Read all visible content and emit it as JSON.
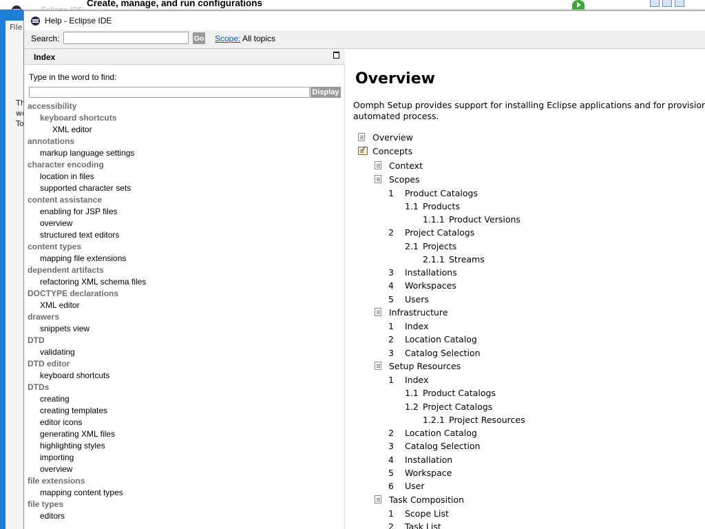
{
  "background_window": {
    "title": "Create, manage, and run configurations",
    "app_label": "Eclipse IDE",
    "menu_file": "File",
    "fragments": [
      "Th",
      "wo",
      "To"
    ]
  },
  "help_window": {
    "title": "Help - Eclipse IDE",
    "search": {
      "label": "Search:",
      "value": "",
      "go_label": "Go",
      "scope_link": "Scope:",
      "scope_value": "All topics"
    }
  },
  "index_pane": {
    "title": "Index",
    "find_label": "Type in the word to find:",
    "find_value": "",
    "display_label": "Display",
    "entries": [
      {
        "level": 0,
        "text": "accessibility"
      },
      {
        "level": "1b",
        "text": "keyboard shortcuts"
      },
      {
        "level": 2,
        "text": "XML editor"
      },
      {
        "level": 0,
        "text": "annotations"
      },
      {
        "level": 1,
        "text": "markup language settings"
      },
      {
        "level": 0,
        "text": "character encoding"
      },
      {
        "level": 1,
        "text": "location in files"
      },
      {
        "level": 1,
        "text": "supported character sets"
      },
      {
        "level": 0,
        "text": "content assistance"
      },
      {
        "level": 1,
        "text": "enabling for JSP files"
      },
      {
        "level": 1,
        "text": "overview"
      },
      {
        "level": 1,
        "text": "structured text editors"
      },
      {
        "level": 0,
        "text": "content types"
      },
      {
        "level": 1,
        "text": "mapping file extensions"
      },
      {
        "level": 0,
        "text": "dependent artifacts"
      },
      {
        "level": 1,
        "text": "refactoring XML schema files"
      },
      {
        "level": 0,
        "text": "DOCTYPE declarations"
      },
      {
        "level": 1,
        "text": "XML editor"
      },
      {
        "level": 0,
        "text": "drawers"
      },
      {
        "level": 1,
        "text": "snippets view"
      },
      {
        "level": 0,
        "text": "DTD"
      },
      {
        "level": 1,
        "text": "validating"
      },
      {
        "level": 0,
        "text": "DTD editor"
      },
      {
        "level": 1,
        "text": "keyboard shortcuts"
      },
      {
        "level": 0,
        "text": "DTDs"
      },
      {
        "level": 1,
        "text": "creating"
      },
      {
        "level": 1,
        "text": "creating templates"
      },
      {
        "level": 1,
        "text": "editor icons"
      },
      {
        "level": 1,
        "text": "generating XML files"
      },
      {
        "level": 1,
        "text": "highlighting styles"
      },
      {
        "level": 1,
        "text": "importing"
      },
      {
        "level": 1,
        "text": "overview"
      },
      {
        "level": 0,
        "text": "file extensions"
      },
      {
        "level": 1,
        "text": "mapping content types"
      },
      {
        "level": 0,
        "text": "file types"
      },
      {
        "level": 1,
        "text": "editors"
      }
    ]
  },
  "content_pane": {
    "title": "Overview",
    "intro_line1": "Oomph Setup provides support for installing Eclipse applications and for provisioning Ec",
    "intro_line2": "automated process.",
    "toc": [
      {
        "icon": "page",
        "num": "",
        "text": "Overview",
        "indent": 0
      },
      {
        "icon": "book",
        "num": "",
        "text": "Concepts",
        "indent": 0
      },
      {
        "icon": "page",
        "num": "",
        "text": "Context",
        "indent": 1
      },
      {
        "icon": "page",
        "num": "",
        "text": "Scopes",
        "indent": 1
      },
      {
        "icon": "",
        "num": "1",
        "text": "Product Catalogs",
        "indent": 1
      },
      {
        "icon": "",
        "num": "1.1",
        "text": "Products",
        "indent": 2
      },
      {
        "icon": "",
        "num": "1.1.1",
        "text": "Product Versions",
        "indent": 3
      },
      {
        "icon": "",
        "num": "2",
        "text": "Project Catalogs",
        "indent": 1
      },
      {
        "icon": "",
        "num": "2.1",
        "text": "Projects",
        "indent": 2
      },
      {
        "icon": "",
        "num": "2.1.1",
        "text": "Streams",
        "indent": 3
      },
      {
        "icon": "",
        "num": "3",
        "text": "Installations",
        "indent": 1
      },
      {
        "icon": "",
        "num": "4",
        "text": "Workspaces",
        "indent": 1
      },
      {
        "icon": "",
        "num": "5",
        "text": "Users",
        "indent": 1
      },
      {
        "icon": "page",
        "num": "",
        "text": "Infrastructure",
        "indent": 1
      },
      {
        "icon": "",
        "num": "1",
        "text": "Index",
        "indent": 1
      },
      {
        "icon": "",
        "num": "2",
        "text": "Location Catalog",
        "indent": 1
      },
      {
        "icon": "",
        "num": "3",
        "text": "Catalog Selection",
        "indent": 1
      },
      {
        "icon": "page",
        "num": "",
        "text": "Setup Resources",
        "indent": 1
      },
      {
        "icon": "",
        "num": "1",
        "text": "Index",
        "indent": 1
      },
      {
        "icon": "",
        "num": "1.1",
        "text": "Product Catalogs",
        "indent": 2
      },
      {
        "icon": "",
        "num": "1.2",
        "text": "Project Catalogs",
        "indent": 2
      },
      {
        "icon": "",
        "num": "1.2.1",
        "text": "Project Resources",
        "indent": 3
      },
      {
        "icon": "",
        "num": "2",
        "text": "Location Catalog",
        "indent": 1
      },
      {
        "icon": "",
        "num": "3",
        "text": "Catalog Selection",
        "indent": 1
      },
      {
        "icon": "",
        "num": "4",
        "text": "Installation",
        "indent": 1
      },
      {
        "icon": "",
        "num": "5",
        "text": "Workspace",
        "indent": 1
      },
      {
        "icon": "",
        "num": "6",
        "text": "User",
        "indent": 1
      },
      {
        "icon": "page",
        "num": "",
        "text": "Task Composition",
        "indent": 1
      },
      {
        "icon": "",
        "num": "1",
        "text": "Scope List",
        "indent": 1
      },
      {
        "icon": "",
        "num": "2",
        "text": "Task List",
        "indent": 1
      }
    ]
  }
}
